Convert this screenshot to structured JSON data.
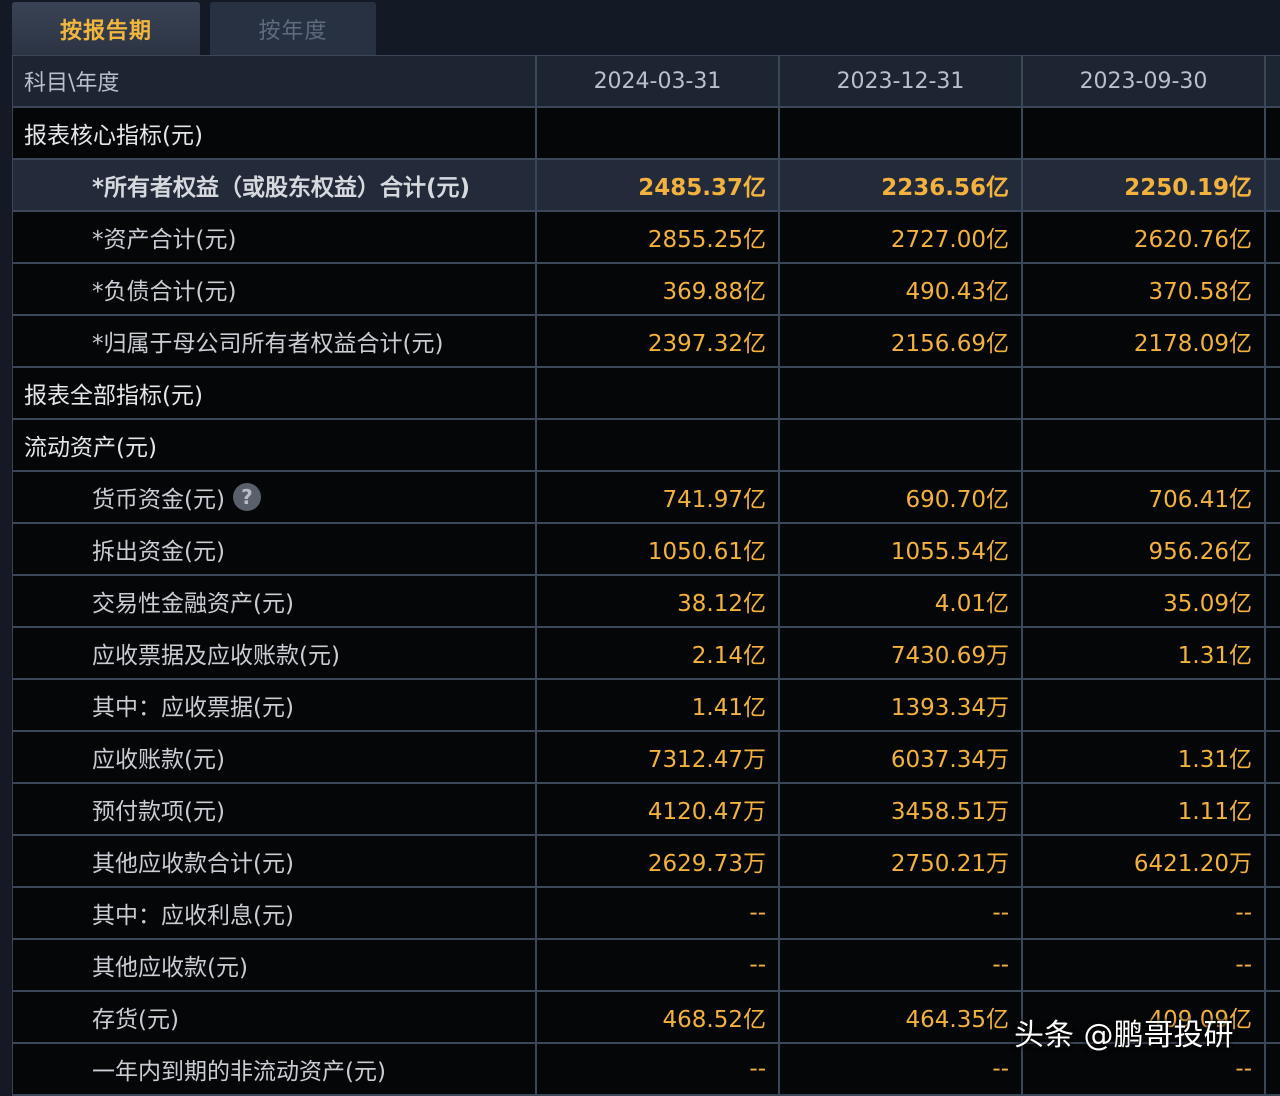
{
  "tabs": {
    "active": "按报告期",
    "inactive": "按年度"
  },
  "table": {
    "header": {
      "label": "科目\\年度",
      "dates": [
        "2024-03-31",
        "2023-12-31",
        "2023-09-30"
      ]
    },
    "rows": [
      {
        "label": "报表核心指标(元)",
        "values": [
          "",
          "",
          ""
        ]
      },
      {
        "label": "*所有者权益（或股东权益）合计(元)",
        "values": [
          "2485.37亿",
          "2236.56亿",
          "2250.19亿"
        ]
      },
      {
        "label": "*资产合计(元)",
        "values": [
          "2855.25亿",
          "2727.00亿",
          "2620.76亿"
        ]
      },
      {
        "label": "*负债合计(元)",
        "values": [
          "369.88亿",
          "490.43亿",
          "370.58亿"
        ]
      },
      {
        "label": "*归属于母公司所有者权益合计(元)",
        "values": [
          "2397.32亿",
          "2156.69亿",
          "2178.09亿"
        ]
      },
      {
        "label": "报表全部指标(元)",
        "values": [
          "",
          "",
          ""
        ]
      },
      {
        "label": "流动资产(元)",
        "values": [
          "",
          "",
          ""
        ]
      },
      {
        "label": "货币资金(元)",
        "values": [
          "741.97亿",
          "690.70亿",
          "706.41亿"
        ]
      },
      {
        "label": "拆出资金(元)",
        "values": [
          "1050.61亿",
          "1055.54亿",
          "956.26亿"
        ]
      },
      {
        "label": "交易性金融资产(元)",
        "values": [
          "38.12亿",
          "4.01亿",
          "35.09亿"
        ]
      },
      {
        "label": "应收票据及应收账款(元)",
        "values": [
          "2.14亿",
          "7430.69万",
          "1.31亿"
        ]
      },
      {
        "label": "其中：应收票据(元)",
        "values": [
          "1.41亿",
          "1393.34万",
          ""
        ]
      },
      {
        "label": "应收账款(元)",
        "values": [
          "7312.47万",
          "6037.34万",
          "1.31亿"
        ]
      },
      {
        "label": "预付款项(元)",
        "values": [
          "4120.47万",
          "3458.51万",
          "1.11亿"
        ]
      },
      {
        "label": "其他应收款合计(元)",
        "values": [
          "2629.73万",
          "2750.21万",
          "6421.20万"
        ]
      },
      {
        "label": "其中：应收利息(元)",
        "values": [
          "--",
          "--",
          "--"
        ]
      },
      {
        "label": "其他应收款(元)",
        "values": [
          "--",
          "--",
          "--"
        ]
      },
      {
        "label": "存货(元)",
        "values": [
          "468.52亿",
          "464.35亿",
          "409.09亿"
        ]
      },
      {
        "label": "一年内到期的非流动资产(元)",
        "values": [
          "--",
          "--",
          "--"
        ]
      }
    ]
  },
  "watermark": "头条 @鹏哥投研",
  "colors": {
    "value": "#f3b23d",
    "background": "#050608",
    "header_bg": "#1d2432",
    "border": "#3c4659"
  }
}
